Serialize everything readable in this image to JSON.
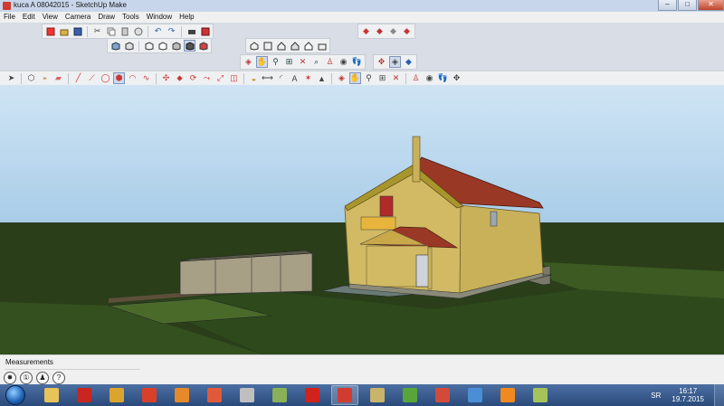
{
  "window": {
    "title": "kuca A 08042015 - SketchUp Make",
    "min_glyph": "–",
    "max_glyph": "□",
    "close_glyph": "✕"
  },
  "menu": [
    "File",
    "Edit",
    "View",
    "Camera",
    "Draw",
    "Tools",
    "Window",
    "Help"
  ],
  "status": {
    "measurements_label": "Measurements",
    "icons": [
      "geo-location-icon",
      "credits-icon",
      "user-icon",
      "help-icon"
    ],
    "help_glyph": "?"
  },
  "taskbar": {
    "apps": [
      {
        "name": "windows-explorer-icon",
        "color": "#e8c35a"
      },
      {
        "name": "acrobat-icon",
        "color": "#c8261e"
      },
      {
        "name": "chrome-icon",
        "color": "#dba42c"
      },
      {
        "name": "presentation-icon",
        "color": "#d8402a"
      },
      {
        "name": "media-player-icon",
        "color": "#e5892a"
      },
      {
        "name": "gallery-icon",
        "color": "#e05a3a"
      },
      {
        "name": "disc-icon",
        "color": "#bfbfbf"
      },
      {
        "name": "network-icon",
        "color": "#8ab05a"
      },
      {
        "name": "opera-icon",
        "color": "#d1221b"
      },
      {
        "name": "sketchup-icon",
        "color": "#d23b2f",
        "active": true
      },
      {
        "name": "tools-icon",
        "color": "#c8b46a"
      },
      {
        "name": "utorrent-icon",
        "color": "#58a63a"
      },
      {
        "name": "layout-icon",
        "color": "#d24a3a"
      },
      {
        "name": "chrome-browser-icon",
        "color": "#4a8ed6"
      },
      {
        "name": "vlc-icon",
        "color": "#f08a1e"
      },
      {
        "name": "paint-icon",
        "color": "#a6c25a"
      }
    ],
    "lang": "SR",
    "time": "16:17",
    "date": "19.7.2015"
  },
  "colors": {
    "sky": "#b9d7ee",
    "ground": "#2a3e1a",
    "wall": "#c9b15a",
    "roof": "#9a3826",
    "shed": "#a89f87"
  }
}
